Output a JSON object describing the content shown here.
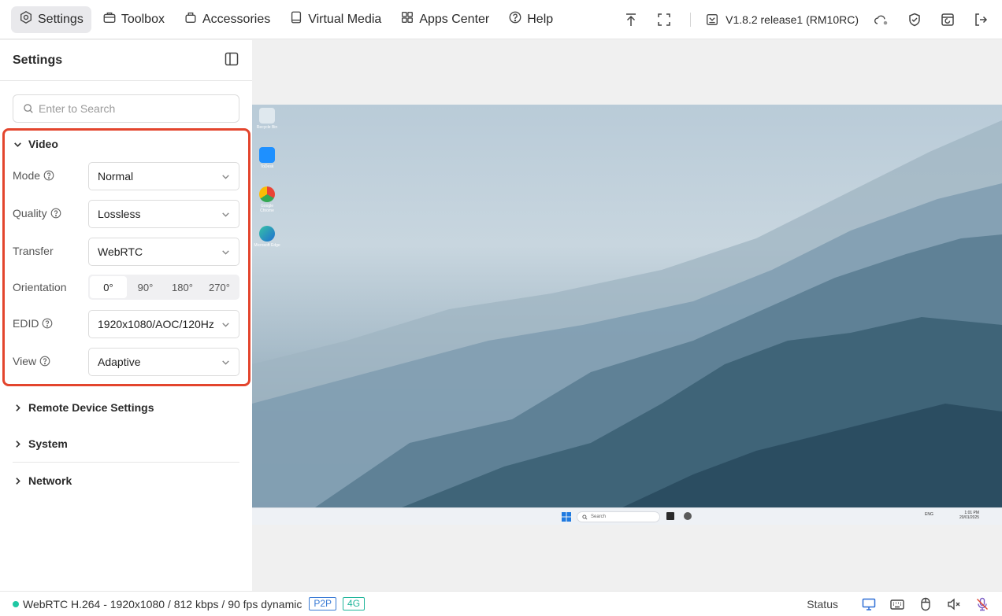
{
  "nav": {
    "settings": "Settings",
    "toolbox": "Toolbox",
    "accessories": "Accessories",
    "virtual_media": "Virtual Media",
    "apps_center": "Apps Center",
    "help": "Help"
  },
  "toolbar": {
    "version": "V1.8.2 release1 (RM10RC)"
  },
  "sidebar": {
    "title": "Settings",
    "search_placeholder": "Enter to Search",
    "video": {
      "title": "Video",
      "mode": {
        "label": "Mode",
        "value": "Normal"
      },
      "quality": {
        "label": "Quality",
        "value": "Lossless"
      },
      "transfer": {
        "label": "Transfer",
        "value": "WebRTC"
      },
      "orientation": {
        "label": "Orientation",
        "options": [
          "0°",
          "90°",
          "180°",
          "270°"
        ],
        "selected": "0°"
      },
      "edid": {
        "label": "EDID",
        "value": "1920x1080/AOC/120Hz"
      },
      "view": {
        "label": "View",
        "value": "Adaptive"
      }
    },
    "sections": {
      "remote": "Remote Device Settings",
      "system": "System",
      "network": "Network"
    }
  },
  "remote_screen": {
    "icons": [
      "Recycle Bin",
      "ToDesk",
      "Google Chrome",
      "Microsoft Edge"
    ],
    "taskbar_search": "Search",
    "tray_lang": "ENG",
    "tray_time": "1:01 PM",
    "tray_date": "20/01/2025"
  },
  "statusbar": {
    "stream": "WebRTC H.264 - 1920x1080 /  812 kbps / 90 fps dynamic",
    "tag_p2p": "P2P",
    "tag_4g": "4G",
    "status_label": "Status"
  },
  "colors": {
    "highlight_border": "#e3452d",
    "connected_dot": "#1fc7a3",
    "tag_blue": "#3a7bd5",
    "tag_green": "#1fb59a",
    "mic_icon": "#7b5cc4"
  }
}
